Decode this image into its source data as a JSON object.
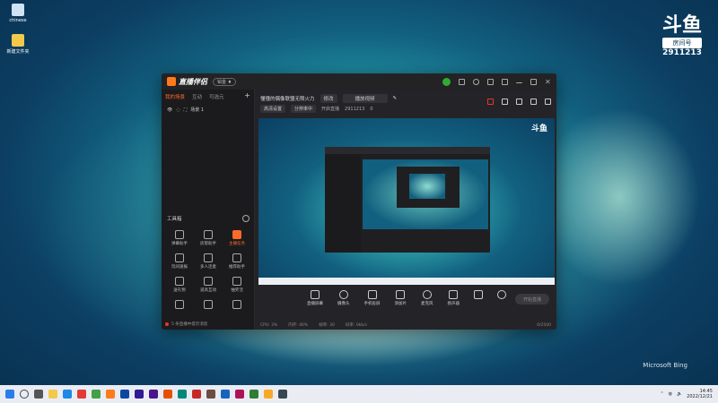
{
  "desktop": {
    "icons": [
      {
        "label": "chinese",
        "icon": "recycle-bin-icon"
      },
      {
        "label": "新建文件夹",
        "icon": "folder-icon"
      }
    ],
    "watermark": {
      "logo": "斗鱼",
      "tag": "房间号",
      "room": "2911213"
    },
    "bing": "Microsoft Bing"
  },
  "app": {
    "name": "直播伴侣",
    "version_badge": "铂金 ♦",
    "tabs": [
      "我的场景",
      "互动",
      "可选元"
    ],
    "scene_name": "场景 1",
    "tools_title": "工具箱",
    "tools": [
      {
        "label": "弹幕助手",
        "icon": "danmaku-icon"
      },
      {
        "label": "房管助手",
        "icon": "admin-icon"
      },
      {
        "label": "主播任务",
        "icon": "task-icon",
        "hot": true
      },
      {
        "label": "玩间速报",
        "icon": "report-icon"
      },
      {
        "label": "多人连麦",
        "icon": "multi-mic-icon"
      },
      {
        "label": "推荐助手",
        "icon": "recommend-icon"
      },
      {
        "label": "送礼物",
        "icon": "gift-icon"
      },
      {
        "label": "道具互动",
        "icon": "props-icon"
      },
      {
        "label": "抽奖活",
        "icon": "lottery-icon"
      },
      {
        "label": "",
        "icon": "extra-icon"
      },
      {
        "label": "",
        "icon": "extra-icon"
      },
      {
        "label": "",
        "icon": "extra-icon"
      }
    ],
    "side_notice": "5 条直播中提示消息",
    "room_title": "懂懂的偶像联盟无限火力",
    "edit_label": "修改",
    "category": "播放视频",
    "sub_chip1": "高清设置",
    "sub_chip2": "分辨率中",
    "record_label": "开启直播",
    "room_id": "2911213",
    "fans": "0",
    "bottom_tools": [
      "直播屏幕",
      "摄像头",
      "手机投屏",
      "添加片",
      "麦克风",
      "扬声器"
    ],
    "start_button": "开始直播",
    "status": [
      "CPU: 3%",
      "内存: 40%",
      "帧率: 30",
      "码率: 0kb/s"
    ],
    "status_right": "0/2500"
  },
  "taskbar": {
    "time": "14:45",
    "date": "2022/12/21"
  },
  "colors": {
    "accent": "#ff6a2a",
    "window": "#1f1f22",
    "taskbar": "#e9edf3"
  }
}
